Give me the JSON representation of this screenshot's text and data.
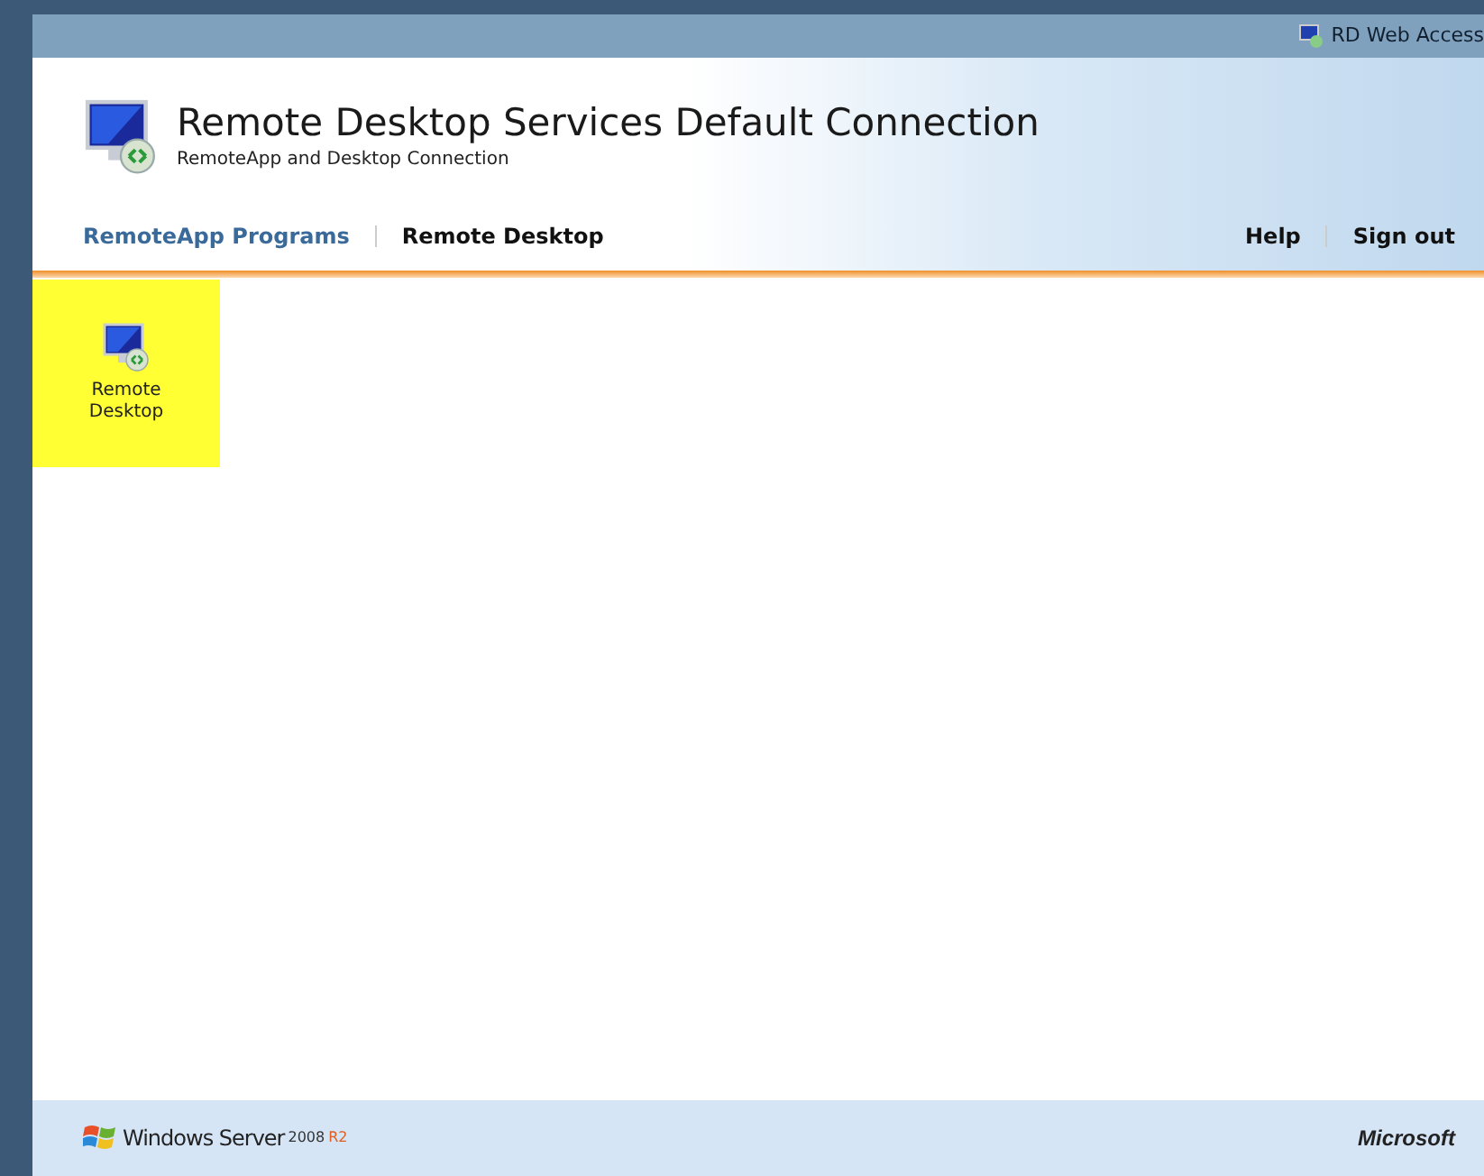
{
  "top_bar": {
    "label": "RD Web Access"
  },
  "header": {
    "title": "Remote Desktop Services Default Connection",
    "subtitle": "RemoteApp and Desktop Connection"
  },
  "tabs": [
    {
      "label": "RemoteApp Programs",
      "selected": true
    },
    {
      "label": "Remote Desktop",
      "selected": false
    }
  ],
  "links": [
    "Help",
    "Sign out"
  ],
  "programs": [
    {
      "label": "Remote Desktop",
      "selected": true
    }
  ],
  "footer": {
    "product": "Windows Server",
    "version": "2008",
    "edition": "R2",
    "vendor": "Microsoft"
  }
}
